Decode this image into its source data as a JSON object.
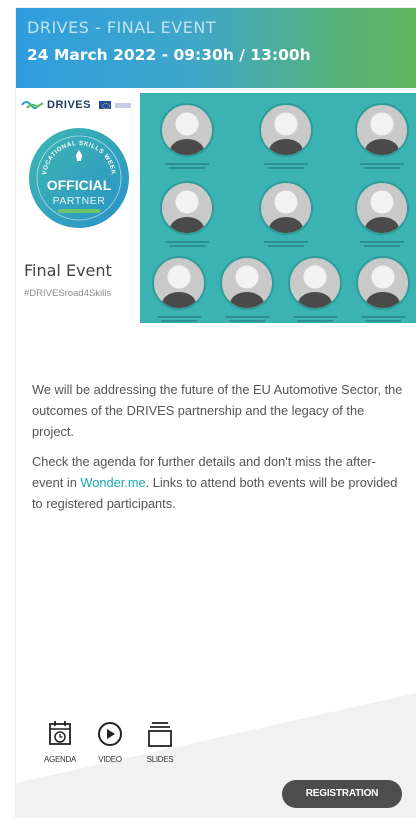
{
  "header": {
    "event_label": "DRIVES - FINAL EVENT",
    "event_date": "24 March 2022 - 09:30h / 13:00h"
  },
  "banner": {
    "logo_text": "DRIVES",
    "badge_top": "VOCATIONAL SKILLS WEEK",
    "badge_main": "OFFICIAL",
    "badge_sub": "PARTNER",
    "title": "Final Event",
    "hashtag": "#DRIVESroad4Skills"
  },
  "content": {
    "paragraph1": "We will be addressing the future of the EU Automotive Sector, the outcomes of the DRIVES partnership and the legacy of the project.",
    "paragraph2_before": "Check the agenda for further details and don't miss the after-event in ",
    "paragraph2_link": "Wonder.me",
    "paragraph2_after": ". Links to attend both events will be provided to registered participants."
  },
  "tools": [
    {
      "label": "AGENDA",
      "icon": "calendar-clock-icon"
    },
    {
      "label": "VIDEO",
      "icon": "play-circle-icon"
    },
    {
      "label": "SLIDES",
      "icon": "slides-stack-icon"
    }
  ],
  "actions": {
    "register_label": "REGISTRATION"
  },
  "colors": {
    "header_start": "#2f9ede",
    "header_end": "#62b55e",
    "banner_teal": "#3ab3b2",
    "link": "#19a5b0",
    "button": "#4d4d4d"
  }
}
